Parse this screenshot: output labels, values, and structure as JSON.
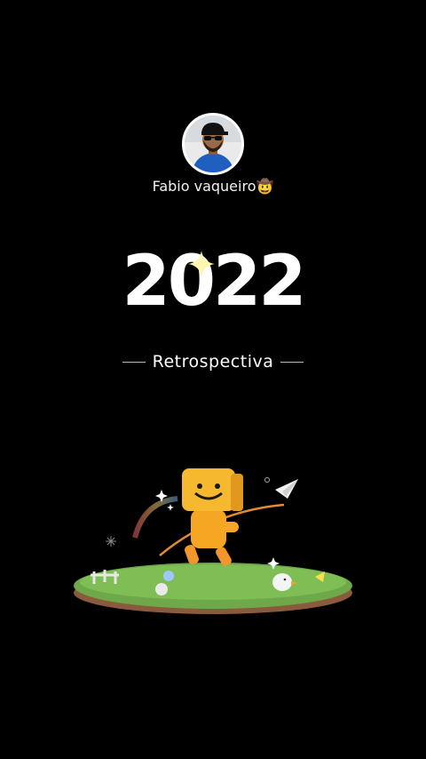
{
  "profile": {
    "name": "Fabio vaqueiro🤠"
  },
  "recap": {
    "year": "2022",
    "subtitle": "Retrospectiva"
  },
  "icons": {
    "sparkle": "sparkle-icon",
    "paper_plane": "paper-plane-icon",
    "mascot": "box-mascot-icon"
  },
  "colors": {
    "background": "#000000",
    "mascot": "#f5a623",
    "grass": "#6fa84a",
    "soil": "#8a5a3c"
  }
}
